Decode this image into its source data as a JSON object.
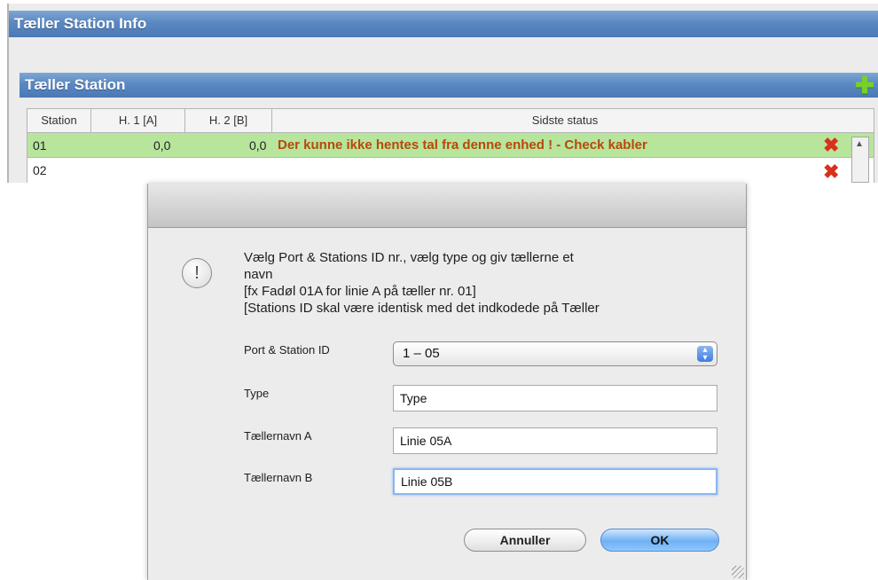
{
  "app": {
    "info_title": "Tæller Station Info",
    "station_title": "Tæller Station",
    "columns": [
      "Station",
      "H. 1 [A]",
      "H. 2 [B]",
      "Sidste status"
    ],
    "rows": [
      {
        "station": "01",
        "h1": "0,0",
        "h2": "0,0",
        "status": "Der kunne ikke hentes tal fra denne enhed ! - Check kabler"
      },
      {
        "station": "02",
        "h1": "",
        "h2": "",
        "status": ""
      }
    ]
  },
  "dialog": {
    "message_lines": [
      "Vælg Port & Stations ID nr., vælg type og giv tællerne et",
      "navn",
      "[fx Fadøl 01A for linie A på tæller nr. 01]",
      "[Stations ID skal være identisk med det indkodede på Tæller"
    ],
    "port_label": "Port & Station ID",
    "port_value": "1 – 05",
    "type_label": "Type",
    "type_value": "Type",
    "name_a_label": "Tællernavn A",
    "name_a_value": "Linie 05A",
    "name_b_label": "Tællernavn B",
    "name_b_value": "Linie 05B",
    "cancel_label": "Annuller",
    "ok_label": "OK"
  }
}
